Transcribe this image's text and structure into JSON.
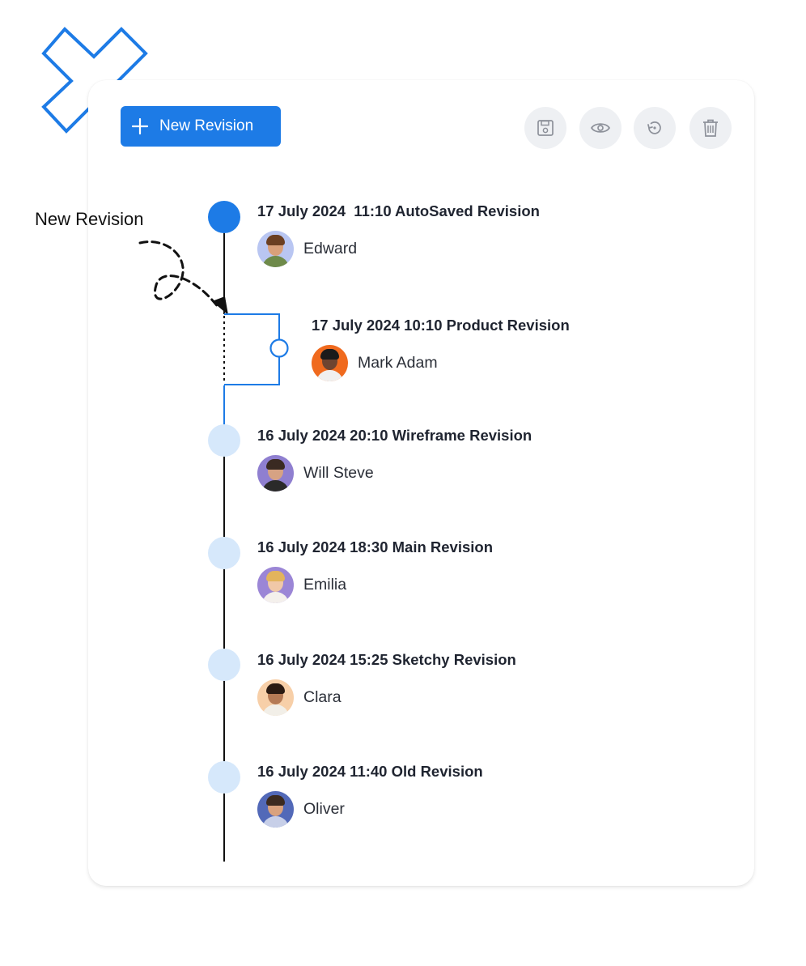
{
  "toolbar": {
    "new_revision_label": "New Revision",
    "icons": [
      "save-icon",
      "eye-icon",
      "restore-icon",
      "trash-icon"
    ]
  },
  "annotation": {
    "label": "New Revision"
  },
  "colors": {
    "accent": "#1d7be6",
    "node_inactive": "#d6e8fb",
    "tool_bg": "#eef0f3",
    "logo": "#1d7be6"
  },
  "revisions": [
    {
      "title": "17 July 2024  11:10 AutoSaved Revision",
      "author": "Edward",
      "avatar_bg": "#b9c6f2",
      "skin": "#d9a07a",
      "hair": "#6b3f22",
      "shirt": "#6e8a4a"
    },
    {
      "title": "17 July 2024 10:10 Product Revision",
      "author": "Mark Adam",
      "avatar_bg": "#f06a1e",
      "skin": "#6e4430",
      "hair": "#1b1b1b",
      "shirt": "#f0f0f0"
    },
    {
      "title": "16 July 2024 20:10 Wireframe Revision",
      "author": "Will Steve",
      "avatar_bg": "#8f7fd0",
      "skin": "#d6a283",
      "hair": "#3a2a22",
      "shirt": "#2a2a2a"
    },
    {
      "title": "16 July 2024 18:30 Main Revision",
      "author": "Emilia",
      "avatar_bg": "#9b86d6",
      "skin": "#f0c8a8",
      "hair": "#e3b45c",
      "shirt": "#f4f0ec"
    },
    {
      "title": "16 July 2024 15:25 Sketchy Revision",
      "author": "Clara",
      "avatar_bg": "#f7cfa8",
      "skin": "#b57a55",
      "hair": "#2a1a12",
      "shirt": "#f2efe8"
    },
    {
      "title": "16 July 2024 11:40 Old Revision",
      "author": "Oliver",
      "avatar_bg": "#5269b8",
      "skin": "#d9a27e",
      "hair": "#3b2a20",
      "shirt": "#c7cfe8"
    }
  ]
}
